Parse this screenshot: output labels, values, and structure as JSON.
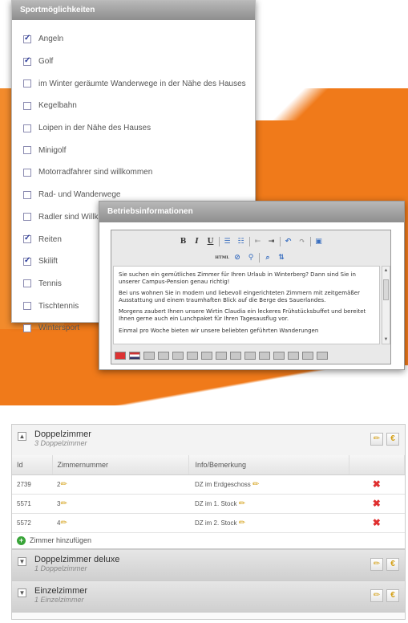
{
  "sports": {
    "title": "Sportmöglichkeiten",
    "items": [
      {
        "label": "Angeln",
        "checked": true
      },
      {
        "label": "Golf",
        "checked": true
      },
      {
        "label": "im Winter geräumte Wanderwege in der Nähe des Hauses",
        "checked": false
      },
      {
        "label": "Kegelbahn",
        "checked": false
      },
      {
        "label": "Loipen in der Nähe des Hauses",
        "checked": false
      },
      {
        "label": "Minigolf",
        "checked": false
      },
      {
        "label": "Motorradfahrer sind willkommen",
        "checked": false
      },
      {
        "label": "Rad- und Wanderwege",
        "checked": false
      },
      {
        "label": "Radler sind Willkommen",
        "checked": false
      },
      {
        "label": "Reiten",
        "checked": true
      },
      {
        "label": "Skilift",
        "checked": true
      },
      {
        "label": "Tennis",
        "checked": false
      },
      {
        "label": "Tischtennis",
        "checked": false
      },
      {
        "label": "Wintersport",
        "checked": false
      }
    ]
  },
  "betrieb": {
    "title": "Betriebsinformationen",
    "toolbar_bold": "B",
    "toolbar_italic": "I",
    "toolbar_underline": "U",
    "toolbar_html": "HTML",
    "paragraphs": [
      "Sie suchen ein gemütliches Zimmer für Ihren Urlaub in Winterberg? Dann sind Sie in unserer Campus-Pension genau richtig!",
      "Bei uns wohnen Sie in modern und liebevoll eingerichteten Zimmern mit zeitgemäßer Ausstattung und einem traumhaften Blick auf die Berge des Sauerlandes.",
      "Morgens zaubert Ihnen unsere Wirtin Claudia ein leckeres Frühstücksbuffet und bereitet Ihnen gerne auch ein Lunchpaket für Ihren Tagesausflug vor.",
      "Einmal pro Woche bieten wir unsere beliebten geführten Wanderungen"
    ]
  },
  "rooms": {
    "groups": [
      {
        "title": "Doppelzimmer",
        "subtitle": "3 Doppelzimmer",
        "expanded": true,
        "columns": [
          "Id",
          "Zimmernummer",
          "Info/Bemerkung"
        ],
        "rows": [
          {
            "id": "2739",
            "nr": "2",
            "info": "DZ im Erdgeschoss"
          },
          {
            "id": "5571",
            "nr": "3",
            "info": "DZ im 1. Stock"
          },
          {
            "id": "5572",
            "nr": "4",
            "info": "DZ im 2. Stock"
          }
        ],
        "add_label": "Zimmer hinzufügen"
      },
      {
        "title": "Doppelzimmer deluxe",
        "subtitle": "1 Doppelzimmer",
        "expanded": false
      },
      {
        "title": "Einzelzimmer",
        "subtitle": "1 Einzelzimmer",
        "expanded": false
      }
    ]
  },
  "icons": {
    "pencil": "✏",
    "delete": "✖",
    "euro": "€",
    "plus": "+",
    "collapse": "▲",
    "expand": "▼"
  }
}
